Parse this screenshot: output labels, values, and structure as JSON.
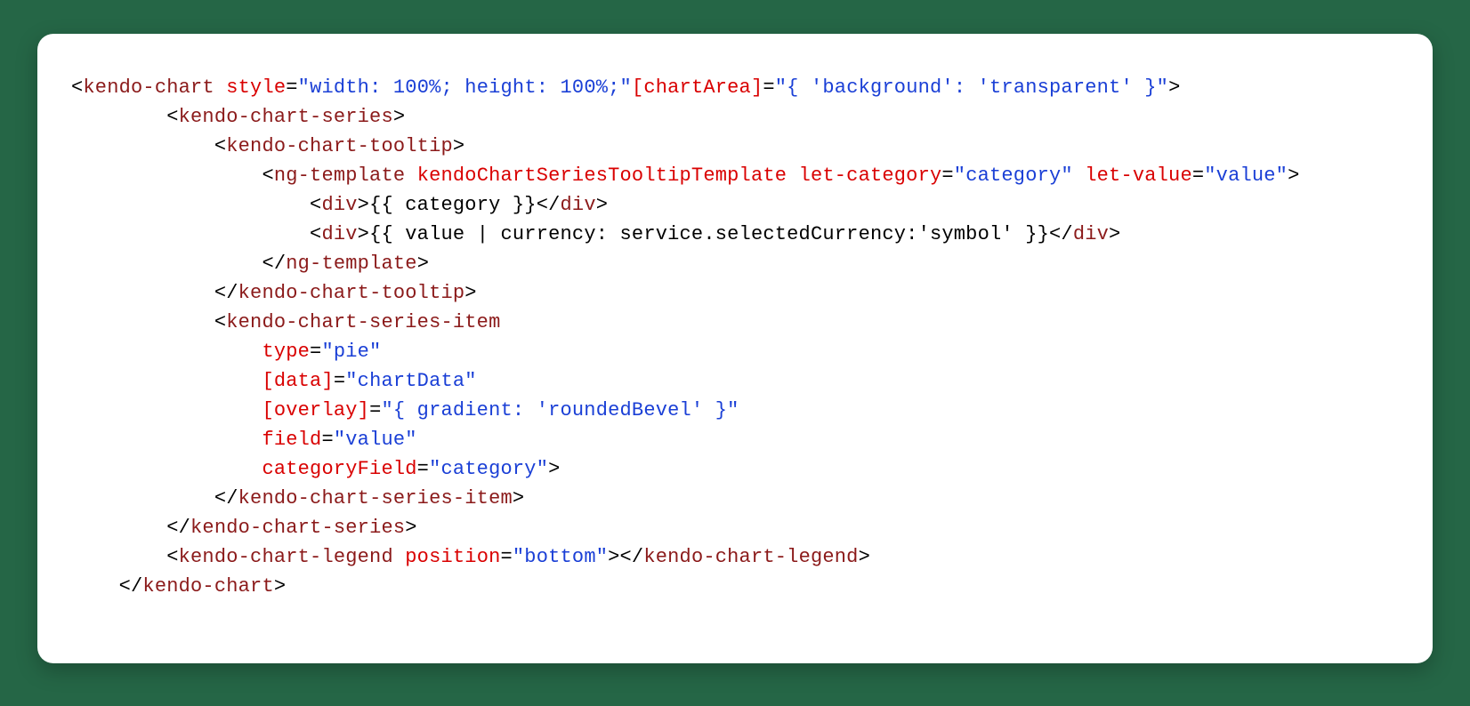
{
  "code": {
    "l1": {
      "tag_open": "kendo-chart",
      "attr1": "style",
      "val1": "\"width: 100%; height: 100%;\"",
      "attr2": "[chartArea]",
      "val2": "\"{ 'background': 'transparent' }\""
    },
    "l2": {
      "tag_open": "kendo-chart-series"
    },
    "l3": {
      "tag_open": "kendo-chart-tooltip"
    },
    "l4": {
      "tag_open": "ng-template",
      "attr1": "kendoChartSeriesTooltipTemplate",
      "attr2": "let-category",
      "val2": "\"category\"",
      "attr3": "let-value",
      "val3": "\"value\""
    },
    "l5": {
      "tag_open": "div",
      "expr": "{{ category }}",
      "tag_close": "div"
    },
    "l6": {
      "tag_open": "div",
      "expr": "{{ value | currency: service.selectedCurrency:'symbol' }}",
      "tag_close": "div"
    },
    "l7": {
      "tag_close": "ng-template"
    },
    "l8": {
      "tag_close": "kendo-chart-tooltip"
    },
    "l9": {
      "tag_open": "kendo-chart-series-item"
    },
    "l10": {
      "attr": "type",
      "val": "\"pie\""
    },
    "l11": {
      "attr": "[data]",
      "val": "\"chartData\""
    },
    "l12": {
      "attr": "[overlay]",
      "val": "\"{ gradient: 'roundedBevel' }\""
    },
    "l13": {
      "attr": "field",
      "val": "\"value\""
    },
    "l14": {
      "attr": "categoryField",
      "val": "\"category\""
    },
    "l15": {
      "tag_close": "kendo-chart-series-item"
    },
    "l16": {
      "tag_close": "kendo-chart-series"
    },
    "l17": {
      "tag_open": "kendo-chart-legend",
      "attr1": "position",
      "val1": "\"bottom\"",
      "tag_close": "kendo-chart-legend"
    },
    "l18": {
      "tag_close": "kendo-chart"
    }
  }
}
